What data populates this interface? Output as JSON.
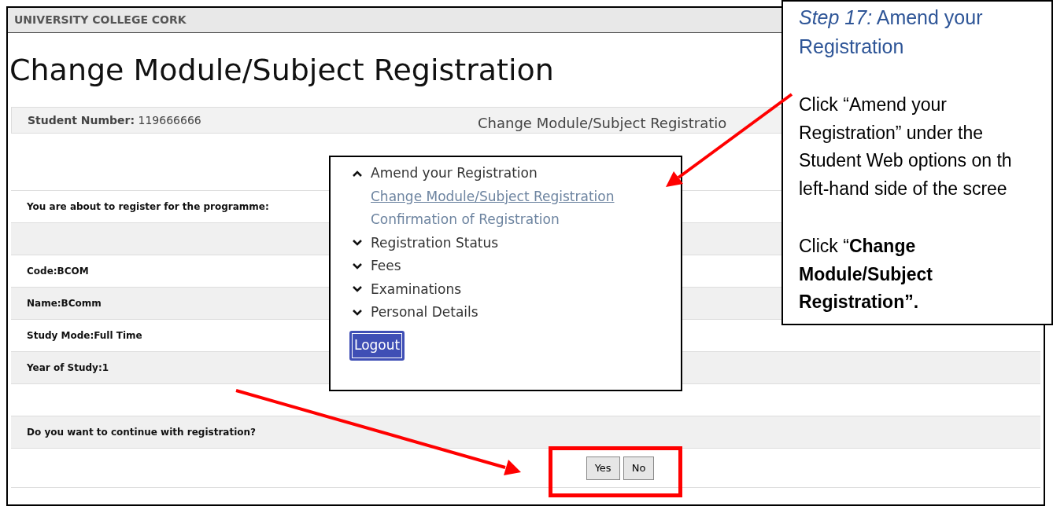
{
  "header": {
    "brand": "UNIVERSITY COLLEGE CORK"
  },
  "title": "Change Module/Subject Registration",
  "info_bar": {
    "student_label": "Student Number:",
    "student_number": "119666666",
    "page_label": "Change Module/Subject Registratio"
  },
  "table": {
    "rows": [
      {
        "text": "You are about to register for the programme:",
        "shaded": false
      },
      {
        "shaded": true
      },
      {
        "text": "Code:BCOM",
        "shaded": false
      },
      {
        "text": "Name:BComm",
        "shaded": true
      },
      {
        "text": "Study Mode:Full Time",
        "shaded": false
      },
      {
        "text": "Year of Study:1",
        "shaded": true
      },
      {
        "shaded": false
      },
      {
        "text": "Do you want to continue with registration?",
        "shaded": true
      }
    ],
    "buttons": [
      "Yes",
      "No"
    ]
  },
  "menu": {
    "items": [
      {
        "label": "Amend your Registration",
        "expanded": true,
        "children": [
          {
            "label": "Change Module/Subject Registration",
            "selected": true
          },
          {
            "label": "Confirmation of Registration",
            "selected": false
          }
        ]
      },
      {
        "label": "Registration Status",
        "expanded": false
      },
      {
        "label": "Fees",
        "expanded": false
      },
      {
        "label": "Examinations",
        "expanded": false
      },
      {
        "label": "Personal Details",
        "expanded": false
      }
    ],
    "logout": "Logout"
  },
  "callout": {
    "heading_lines": [
      "*Step 17:* Amend your",
      "Registration"
    ],
    "paragraphs": [
      [
        "Click “Amend your",
        "Registration” under the",
        "Student Web options on th",
        "left-hand side of the scree"
      ],
      [
        "Click “**Change**",
        "**Module/Subject**",
        "**Registration”.**"
      ]
    ]
  }
}
